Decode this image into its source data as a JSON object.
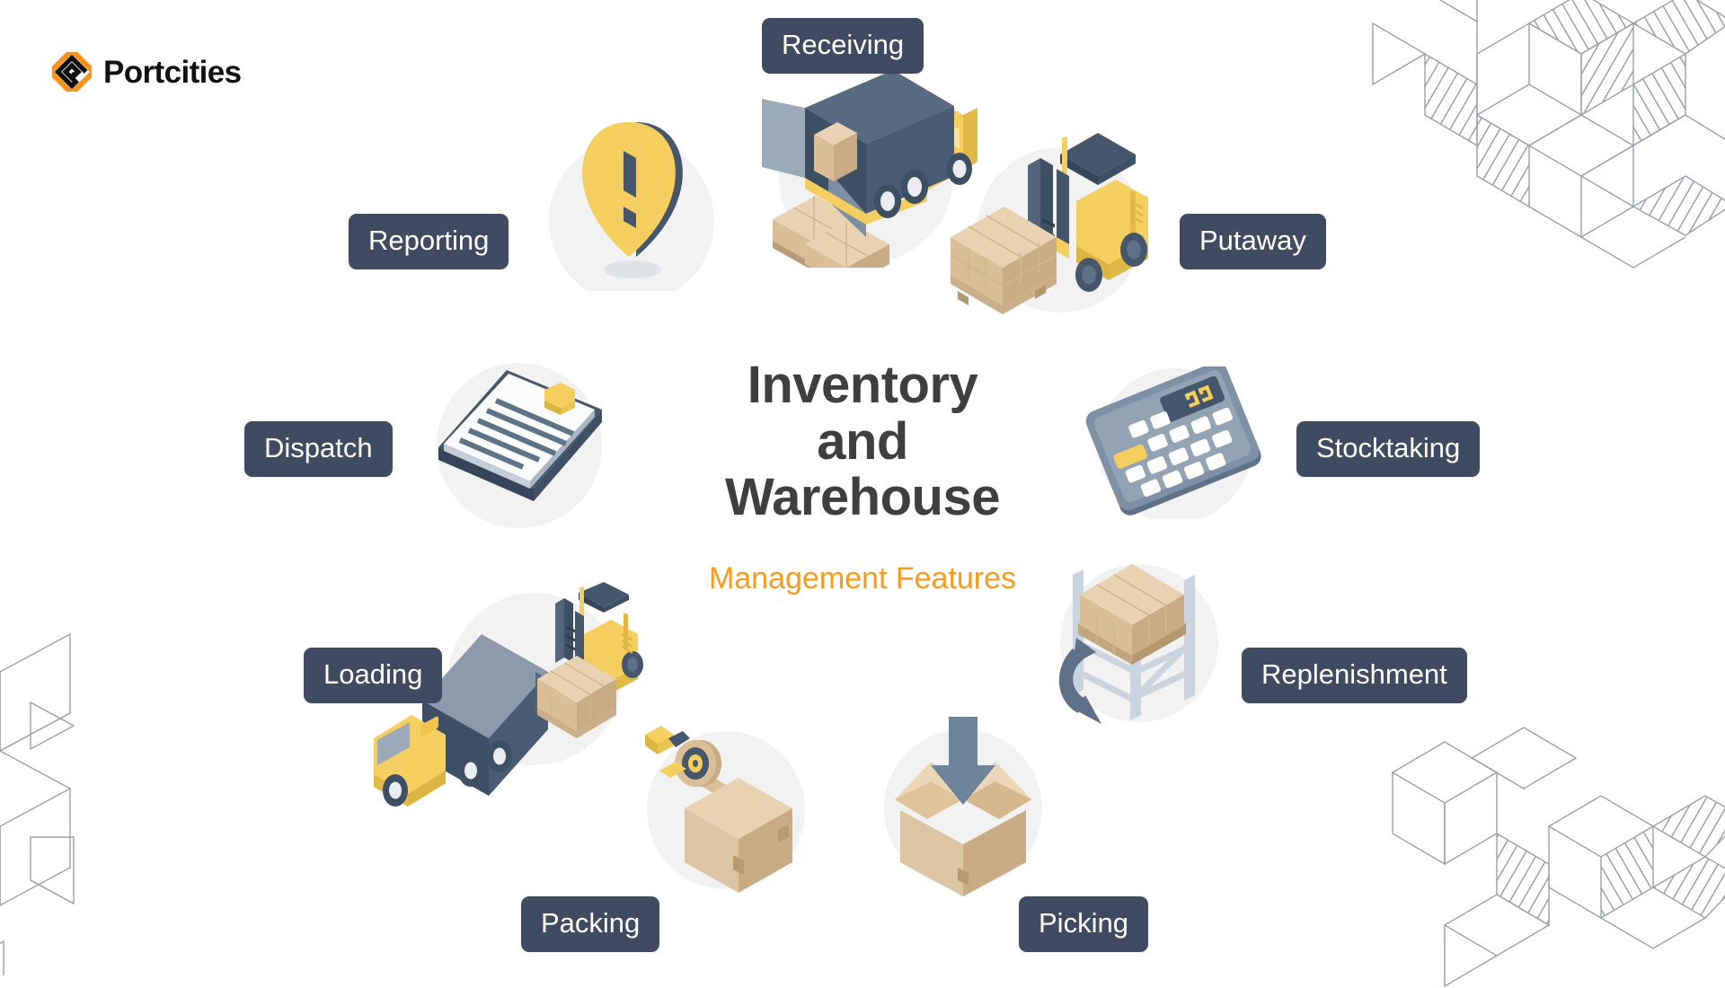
{
  "brand": {
    "name": "Portcities",
    "logo_icon": "portcities-diamond-logo",
    "accent_orange": "#F7941D",
    "mark_dark": "#111111"
  },
  "center": {
    "title_lines": [
      "Inventory",
      "and",
      "Warehouse"
    ],
    "subtitle": "Management Features",
    "title_color": "#3F3F3F",
    "subtitle_color": "#F99B1C"
  },
  "theme": {
    "pill_bg": "#3E4B61",
    "pill_text": "#FFFFFF",
    "blob_bg": "#F2F2F2",
    "pattern_stroke": "#9AA0AE",
    "page_bg": "#FFFFFF",
    "yellow": "#F4CE5E",
    "slate": "#46566B",
    "cardboard": "#E3C9A4"
  },
  "features": [
    {
      "id": "receiving",
      "label": "Receiving",
      "icon": "delivery-truck-unloading-icon"
    },
    {
      "id": "putaway",
      "label": "Putaway",
      "icon": "forklift-pallet-icon"
    },
    {
      "id": "stocktaking",
      "label": "Stocktaking",
      "icon": "calculator-icon"
    },
    {
      "id": "replenishment",
      "label": "Replenishment",
      "icon": "pallet-rack-refresh-icon"
    },
    {
      "id": "picking",
      "label": "Picking",
      "icon": "open-box-down-arrow-icon"
    },
    {
      "id": "packing",
      "label": "Packing",
      "icon": "tape-dispenser-box-icon"
    },
    {
      "id": "loading",
      "label": "Loading",
      "icon": "truck-forklift-loading-icon"
    },
    {
      "id": "dispatch",
      "label": "Dispatch",
      "icon": "clipboard-document-icon"
    },
    {
      "id": "reporting",
      "label": "Reporting",
      "icon": "alert-pin-exclamation-icon"
    }
  ],
  "decorations": [
    {
      "id": "pattern-top-right",
      "icon": "isometric-cube-pattern"
    },
    {
      "id": "pattern-bottom-left",
      "icon": "isometric-cube-pattern"
    },
    {
      "id": "pattern-bottom-right",
      "icon": "isometric-cube-pattern"
    }
  ]
}
